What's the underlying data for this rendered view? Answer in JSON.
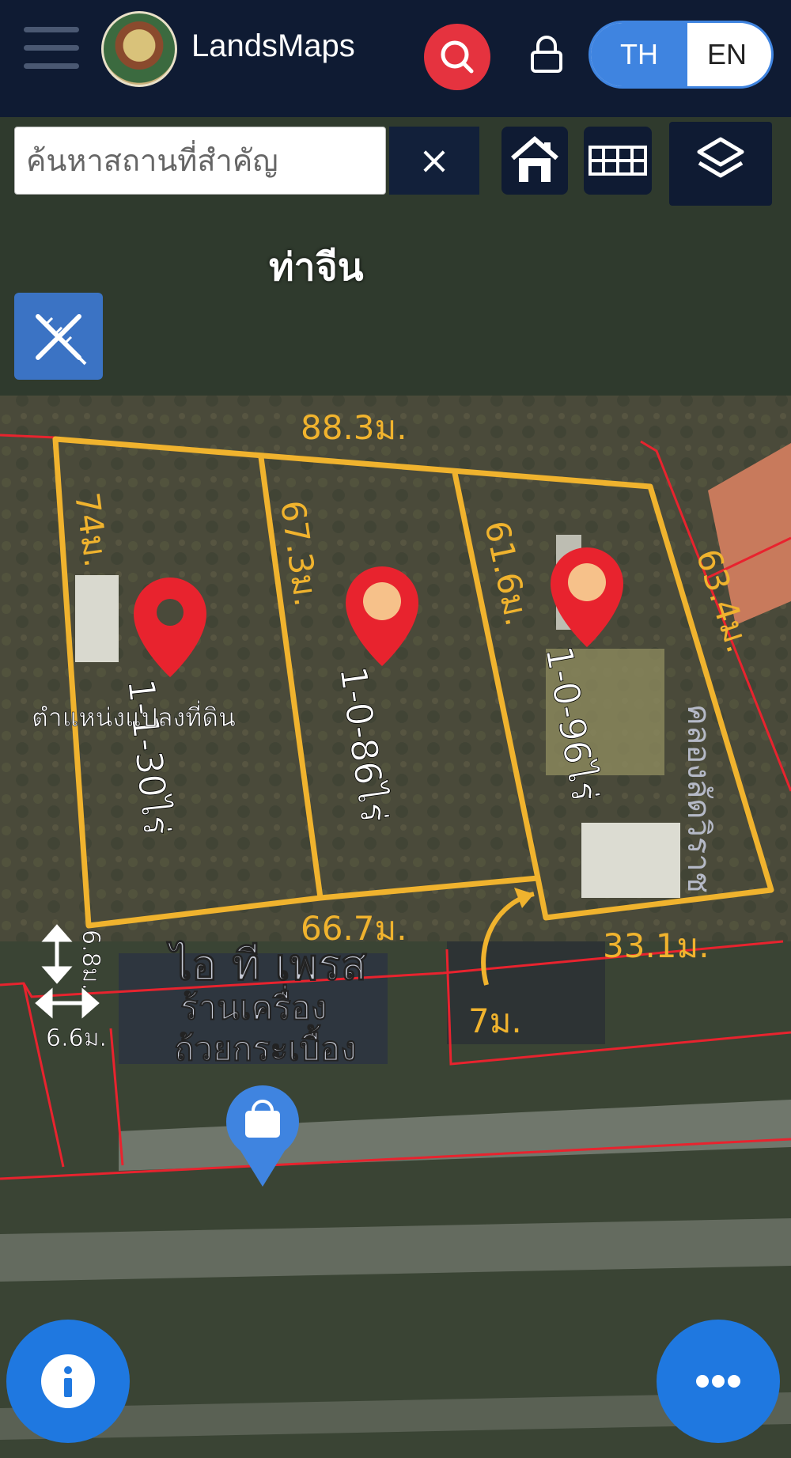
{
  "header": {
    "app_title": "LandsMaps",
    "lang_th": "TH",
    "lang_en": "EN"
  },
  "search": {
    "placeholder": "ค้นหาสถานที่สำคัญ",
    "clear_icon": "×"
  },
  "map": {
    "place_name": "ท่าจีน",
    "dimensions": {
      "top": "88.3ม.",
      "left": "74ม.",
      "div1": "67.3ม.",
      "div2": "61.6ม.",
      "right": "63.4ม.",
      "bottom_left": "66.7ม.",
      "bottom_right": "33.1ม.",
      "access": "7ม.",
      "small_a": "6.8ม.",
      "small_b": "6.6ม."
    },
    "plots": [
      "1-1-30ไร่",
      "1-0-86ไร่",
      "1-0-96ไร่"
    ],
    "parcel_label": "ตำแหน่งแปลงที่ดิน",
    "canal_label": "คลองลัดวิราช",
    "shop_label_1": "ไอ ที เพรส",
    "shop_label_2": "ร้านเครื่อง",
    "shop_label_3": "ถ้วยกระเบื้อง"
  },
  "colors": {
    "header_bg": "#0f1b33",
    "accent_blue": "#3f84e0",
    "search_red": "#e5333f",
    "boundary_yellow": "#f0b32e",
    "parcel_red": "#e8232e"
  }
}
